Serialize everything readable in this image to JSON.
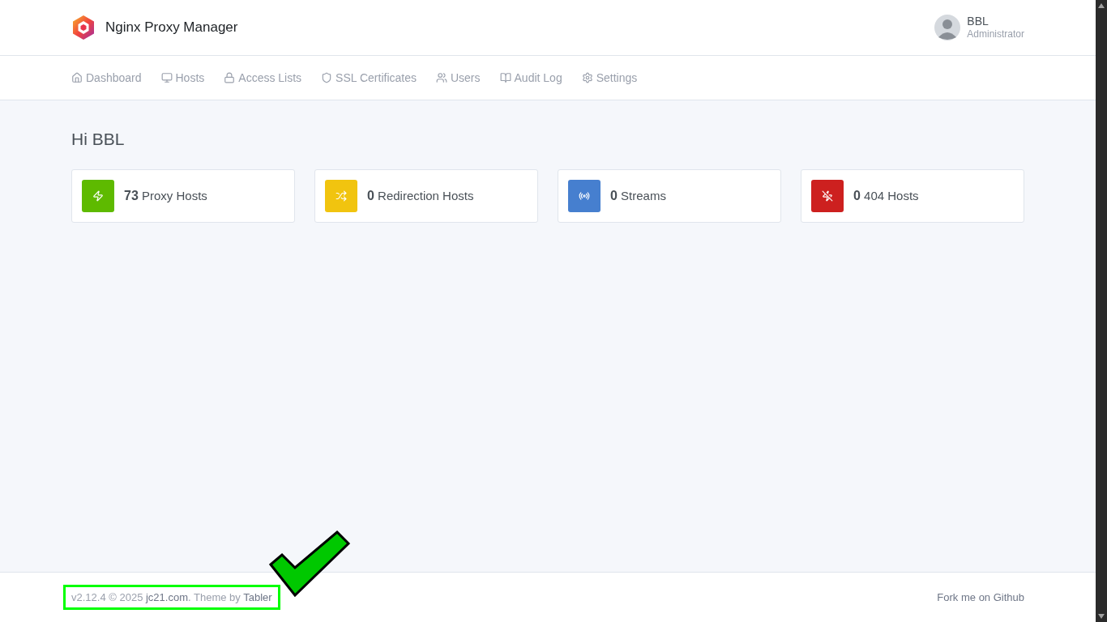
{
  "header": {
    "brand": "Nginx Proxy Manager",
    "user": {
      "name": "BBL",
      "role": "Administrator"
    }
  },
  "nav": [
    {
      "kind": "home",
      "label": "Dashboard"
    },
    {
      "kind": "monitor",
      "label": "Hosts"
    },
    {
      "kind": "lock",
      "label": "Access Lists"
    },
    {
      "kind": "shield",
      "label": "SSL Certificates"
    },
    {
      "kind": "users",
      "label": "Users"
    },
    {
      "kind": "book",
      "label": "Audit Log"
    },
    {
      "kind": "gear",
      "label": "Settings"
    }
  ],
  "greeting": "Hi BBL",
  "stats": [
    {
      "kind": "zap",
      "count": "73",
      "label": "Proxy Hosts",
      "color": "#5eba00"
    },
    {
      "kind": "shuffle",
      "count": "0",
      "label": "Redirection Hosts",
      "color": "#f1c40f"
    },
    {
      "kind": "radio",
      "count": "0",
      "label": "Streams",
      "color": "#467fcf"
    },
    {
      "kind": "zapoff",
      "count": "0",
      "label": "404 Hosts",
      "color": "#cd201f"
    }
  ],
  "footer": {
    "credits": {
      "prefix": "v2.12.4 © 2025 ",
      "link1": "jc21.com",
      "middle": ". Theme by ",
      "link2": "Tabler"
    },
    "github_link": "Fork me on Github"
  }
}
